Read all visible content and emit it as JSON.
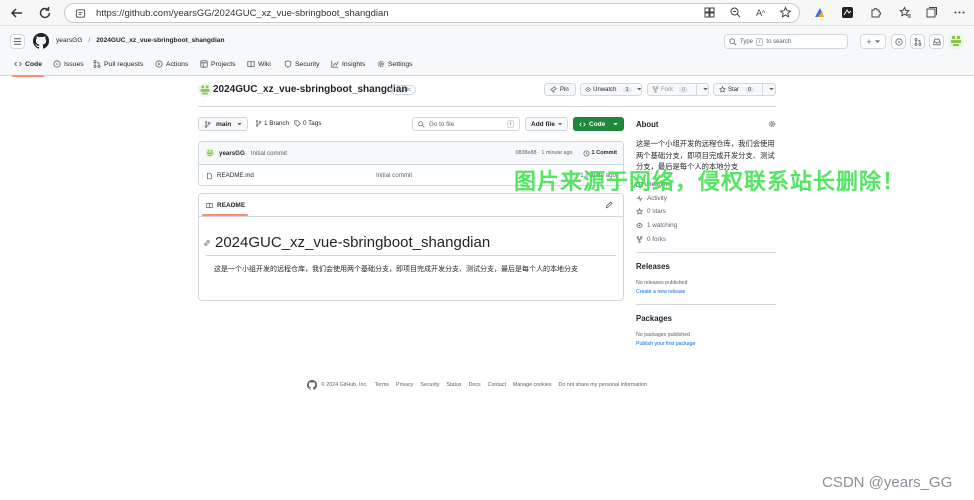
{
  "browser": {
    "url": "https://github.com/yearsGG/2024GUC_xz_vue-sbringboot_shangdian",
    "icons": [
      "back-icon",
      "refresh-icon",
      "site-info-icon",
      "grid-icon",
      "zoom-icon",
      "read-aloud-icon",
      "favorite-icon",
      "extension-icon",
      "app-icon",
      "puzzle-icon",
      "favorites-icon",
      "collections-icon",
      "more-icon"
    ]
  },
  "header": {
    "owner": "yearsGG",
    "separator": "/",
    "repo": "2024GUC_xz_vue-sbringboot_shangdian",
    "search_prefix": "Type",
    "search_key": "/",
    "search_suffix": "to search",
    "plus_label": "+"
  },
  "tabs": [
    {
      "label": "Code",
      "icon": "code-icon",
      "active": true
    },
    {
      "label": "Issues",
      "icon": "issue-icon"
    },
    {
      "label": "Pull requests",
      "icon": "pull-request-icon"
    },
    {
      "label": "Actions",
      "icon": "play-icon"
    },
    {
      "label": "Projects",
      "icon": "table-icon"
    },
    {
      "label": "Wiki",
      "icon": "book-icon"
    },
    {
      "label": "Security",
      "icon": "shield-icon"
    },
    {
      "label": "Insights",
      "icon": "graph-icon"
    },
    {
      "label": "Settings",
      "icon": "gear-icon"
    }
  ],
  "repo": {
    "name": "2024GUC_xz_vue-sbringboot_shangdian",
    "visibility": "Public",
    "pin": "Pin",
    "unwatch": "Unwatch",
    "watch_count": "1",
    "fork": "Fork",
    "fork_count": "0",
    "star": "Star",
    "star_count": "0"
  },
  "toolbar": {
    "branch": "main",
    "branch_count": "1 Branch",
    "tag_count": "0 Tags",
    "go_to_file_placeholder": "Go to file",
    "go_to_file_key": "t",
    "add_file": "Add file",
    "code": "Code"
  },
  "commit": {
    "author": "yearsGG",
    "message": "Initial commit",
    "hash_time": "0838e88 · 1 minute ago",
    "commits": "1 Commit"
  },
  "files": [
    {
      "name": "README.md",
      "message": "Initial commit",
      "time": "1 minute ago"
    }
  ],
  "readme": {
    "tab": "README",
    "title": "2024GUC_xz_vue-sbringboot_shangdian",
    "body": "这是一个小组开发的远程仓库，我们会使用两个基础分支，即项目完成开发分支、测试分支，最后是每个人的本地分支"
  },
  "about": {
    "title": "About",
    "description": "这是一个小组开发的远程仓库，我们会使用两个基础分支，即项目完成开发分支、测试分支，最后是每个人的本地分支",
    "links": [
      {
        "label": "Readme",
        "icon": "book-icon"
      },
      {
        "label": "Activity",
        "icon": "pulse-icon"
      },
      {
        "label": "0 stars",
        "icon": "star-icon"
      },
      {
        "label": "1 watching",
        "icon": "eye-icon"
      },
      {
        "label": "0 forks",
        "icon": "fork-icon"
      }
    ],
    "releases_title": "Releases",
    "releases_empty": "No releases published",
    "releases_link": "Create a new release",
    "packages_title": "Packages",
    "packages_empty": "No packages published",
    "packages_link": "Publish your first package"
  },
  "footer": {
    "copyright": "© 2024 GitHub, Inc.",
    "links": [
      "Terms",
      "Privacy",
      "Security",
      "Status",
      "Docs",
      "Contact",
      "Manage cookies",
      "Do not share my personal information"
    ]
  },
  "overlays": {
    "watermark": "图片来源于网络，侵权联系站长删除！",
    "csdn": "CSDN @years_GG"
  },
  "colors": {
    "green": "#1f883d",
    "accent": "#fd8c73",
    "link": "#0969da",
    "watermark": "#39e04a"
  }
}
